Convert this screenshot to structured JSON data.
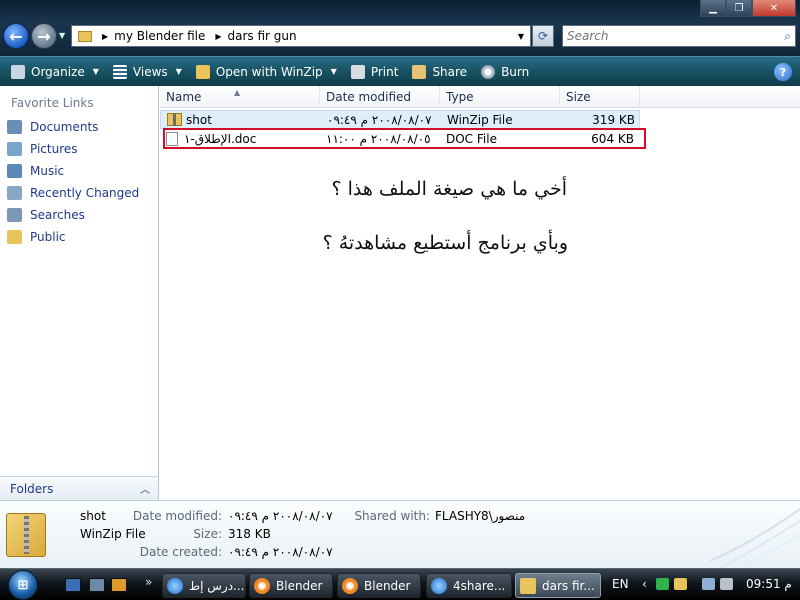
{
  "address": {
    "crumbs": [
      "my Blender file",
      "dars fir gun"
    ]
  },
  "search": {
    "placeholder": "Search"
  },
  "toolbar": {
    "organize": "Organize",
    "views": "Views",
    "open_with": "Open with WinZip",
    "print": "Print",
    "share": "Share",
    "burn": "Burn",
    "help": "?"
  },
  "nav": {
    "favorite_links_title": "Favorite Links",
    "items": [
      "Documents",
      "Pictures",
      "Music",
      "Recently Changed",
      "Searches",
      "Public"
    ],
    "folders_label": "Folders"
  },
  "columns": {
    "name": "Name",
    "date": "Date modified",
    "type": "Type",
    "size": "Size"
  },
  "files": [
    {
      "name": "shot",
      "date": "٢٠٠٨/٠٨/٠٧ م ٠٩:٤٩",
      "type": "WinZip File",
      "size": "319 KB"
    },
    {
      "name": "الإطلاق-١.doc",
      "date": "٢٠٠٨/٠٨/٠٥ م ١١:٠٠",
      "type": "DOC File",
      "size": "604 KB"
    }
  ],
  "message": {
    "line1": "أخي ما هي صيغة الملف هذا ؟",
    "line2": "وبأي برنامج أستطيع مشاهدتهُ ؟"
  },
  "details": {
    "name": "shot",
    "type": "WinZip File",
    "date_modified_label": "Date modified:",
    "date_modified": "٢٠٠٨/٠٨/٠٧ م ٠٩:٤٩",
    "size_label": "Size:",
    "size": "318 KB",
    "date_created_label": "Date created:",
    "date_created": "٢٠٠٨/٠٨/٠٧ م ٠٩:٤٩",
    "shared_label": "Shared with:",
    "shared": "FLASHY8\\منصور"
  },
  "taskbar": {
    "more": "»",
    "buttons": [
      "درس إط...",
      "Blender",
      "Blender",
      "4share...",
      "dars fir..."
    ],
    "lang": "EN",
    "time": "09:51 م"
  }
}
